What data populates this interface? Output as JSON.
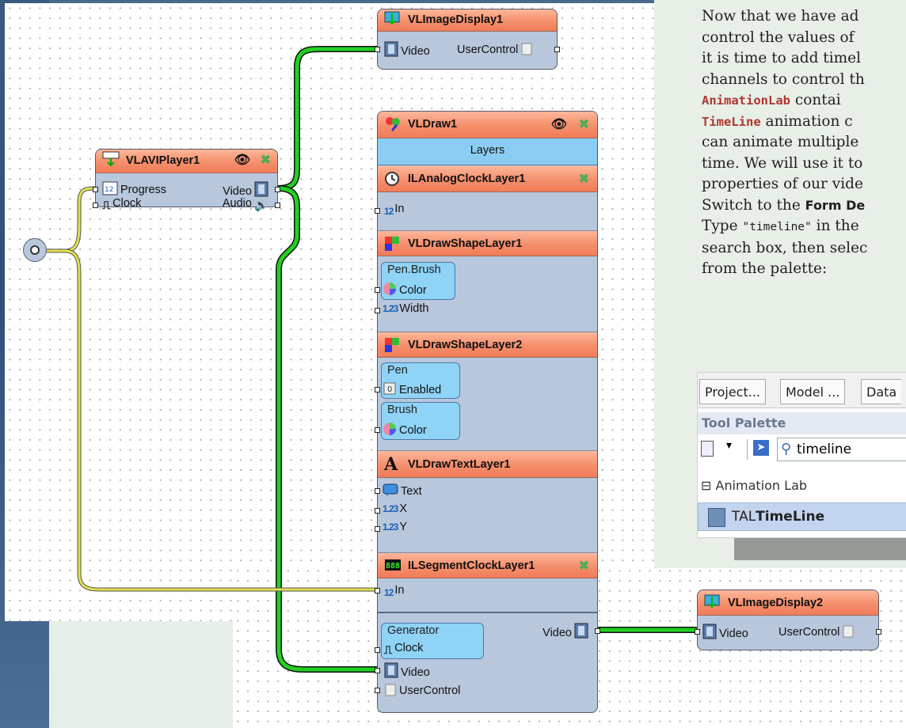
{
  "doc": {
    "lines": [
      "Now that we have ad",
      "control the values of",
      "it is time to add timel",
      "channels to control th",
      {
        "bold": "AnimationLab",
        "rest": " contai"
      },
      {
        "bold": "TimeLine",
        "rest": " animation c"
      },
      "can animate multiple",
      "time. We will use it to",
      "properties of our vide",
      {
        "pre": "Switch to the ",
        "fd": "Form De"
      },
      {
        "pre": "Type ",
        "mono": "\"timeline\"",
        "rest": " in the"
      },
      "search box, then selec",
      "from the palette:"
    ],
    "palette": {
      "tabs": [
        "Project...",
        "Model ...",
        "Data"
      ],
      "title": "Tool Palette",
      "search": "timeline",
      "category": "Animation Lab",
      "item_prefix": "TAL",
      "item_bold": "TimeLine"
    }
  },
  "components": {
    "display1": {
      "title": "VLImageDisplay1",
      "pins": [
        "Video",
        "UserControl"
      ]
    },
    "player": {
      "title": "VLAVIPlayer1",
      "pins": [
        "Progress",
        "Clock",
        "Video",
        "Audio"
      ]
    },
    "draw": {
      "title": "VLDraw1",
      "layers_label": "Layers",
      "analog": {
        "title": "ILAnalogClockLayer1",
        "pin": "In"
      },
      "shape1": {
        "title": "VLDrawShapeLayer1",
        "group": "Pen.Brush",
        "pins": [
          "Color",
          "Width"
        ]
      },
      "shape2": {
        "title": "VLDrawShapeLayer2",
        "group1": "Pen",
        "pin1": "Enabled",
        "group2": "Brush",
        "pin2": "Color"
      },
      "text": {
        "title": "VLDrawTextLayer1",
        "pins": [
          "Text",
          "X",
          "Y"
        ]
      },
      "segment": {
        "title": "ILSegmentClockLayer1",
        "pin": "In"
      },
      "bottom": {
        "group": "Generator",
        "pins": [
          "Clock",
          "Video",
          "UserControl"
        ],
        "out": "Video"
      }
    },
    "display2": {
      "title": "VLImageDisplay2",
      "pins": [
        "Video",
        "UserControl"
      ]
    }
  },
  "colors": {
    "header": "#f48f6c",
    "body": "#b8c7dc",
    "pill": "#8fd3f6",
    "wire_video": "#22d022",
    "wire_clock": "#e0e050"
  }
}
